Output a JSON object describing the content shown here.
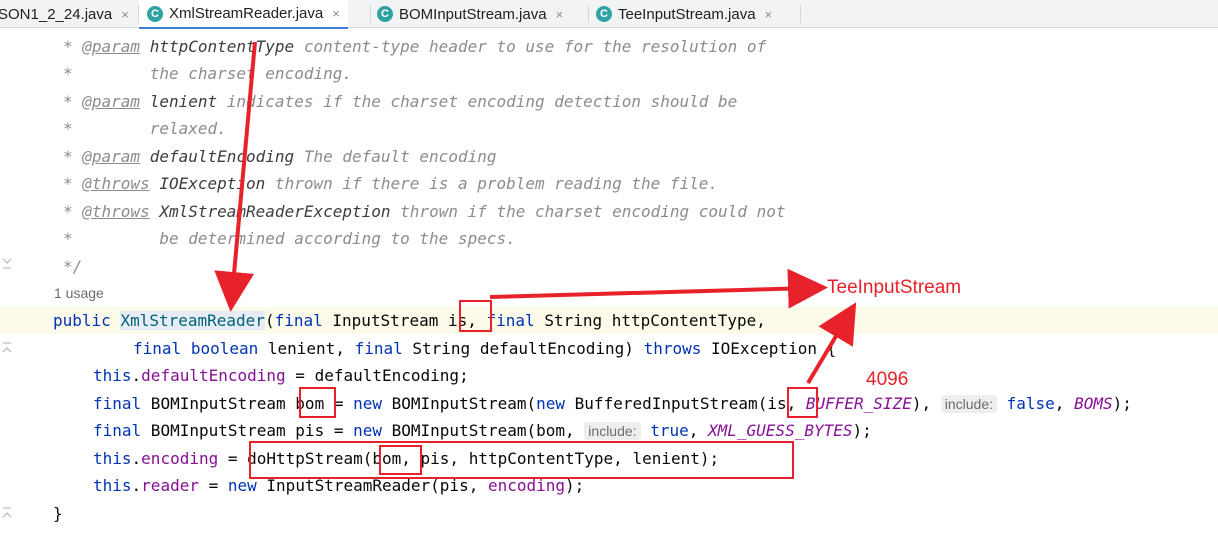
{
  "tabs": [
    {
      "label": "SON1_2_24.java",
      "close": "×",
      "active": false,
      "has_icon": false
    },
    {
      "label": "XmlStreamReader.java",
      "close": "×",
      "active": true,
      "icon": "C"
    },
    {
      "label": "BOMInputStream.java",
      "close": "×",
      "active": false,
      "icon": "C"
    },
    {
      "label": "TeeInputStream.java",
      "close": "×",
      "active": false,
      "icon": "C"
    }
  ],
  "code": {
    "c1_star": "* ",
    "c1_tag": "@param",
    "c1_name": " httpContentType",
    "c1_text": " content-type header to use for the resolution of",
    "c2_text": "*        the charset encoding.",
    "c3_star": "* ",
    "c3_tag": "@param",
    "c3_name": " lenient",
    "c3_text": " indicates if the charset encoding detection should be",
    "c4_text": "*        relaxed.",
    "c5_star": "* ",
    "c5_tag": "@param",
    "c5_name": " defaultEncoding",
    "c5_text": " The default encoding",
    "c6_star": "* ",
    "c6_tag": "@throws",
    "c6_name": " IOException",
    "c6_text": " thrown if there is a problem reading the file.",
    "c7_star": "* ",
    "c7_tag": "@throws",
    "c7_name": " XmlStreamReaderException",
    "c7_text": " thrown if the charset encoding could not",
    "c8_text": "*         be determined according to the specs.",
    "c9_text": "*/",
    "usage": "1 usage",
    "l1_kw": "public ",
    "l1_method": "XmlStreamReader",
    "l1_open": "(",
    "l1_final1": "final",
    "l1_mid1": " InputStream is, ",
    "l1_final2": "final",
    "l1_rest": " String httpContentType,",
    "l2_final1": "final",
    "l2_sp": " ",
    "l2_boolean": "boolean",
    "l2_mid": " lenient, ",
    "l2_final2": "final",
    "l2_mid2": " String defaultEncoding) ",
    "l2_throws": "throws",
    "l2_rest": " IOException {",
    "l3_this": "this",
    "l3_dot": ".",
    "l3_field": "defaultEncoding",
    "l3_rest": " = defaultEncoding;",
    "l4_final": "final",
    "l4_mid": " BOMInputStream bom = ",
    "l4_new1": "new",
    "l4_mid2": " BOMInputStream(",
    "l4_new2": "new",
    "l4_mid3": " BufferedInputStream(is, ",
    "l4_const": "BUFFER_SIZE",
    "l4_comma": "), ",
    "l4_hint": "include:",
    "l4_false": " false",
    "l4_comma2": ", ",
    "l4_boms": "BOMS",
    "l4_end": ");",
    "l5_final": "final",
    "l5_mid": " BOMInputStream pis = ",
    "l5_new": "new",
    "l5_mid2": " BOMInputStream(bom, ",
    "l5_hint": "include:",
    "l5_true": " true",
    "l5_comma": ", ",
    "l5_const": "XML_GUESS_BYTES",
    "l5_end": ");",
    "l6_this": "this",
    "l6_dot": ".",
    "l6_field": "encoding",
    "l6_rest": " = doHttpStream(bom, pis, httpContentType, lenient);",
    "l7_this": "this",
    "l7_dot": ".",
    "l7_field": "reader",
    "l7_eq": " = ",
    "l7_new": "new",
    "l7_mid": " InputStreamReader(pis, ",
    "l7_enc": "encoding",
    "l7_end": ");",
    "l8": "}"
  },
  "annotations": {
    "tee_label": "TeeInputStream",
    "size_label": "4096",
    "color": "#e8222a"
  },
  "colors": {
    "keyword": "#0033b3",
    "field": "#871094",
    "comment": "#8c8c8c",
    "method": "#00627a",
    "tab_icon": "#2fa3a3",
    "active_tab_underline": "#3d7be0"
  }
}
